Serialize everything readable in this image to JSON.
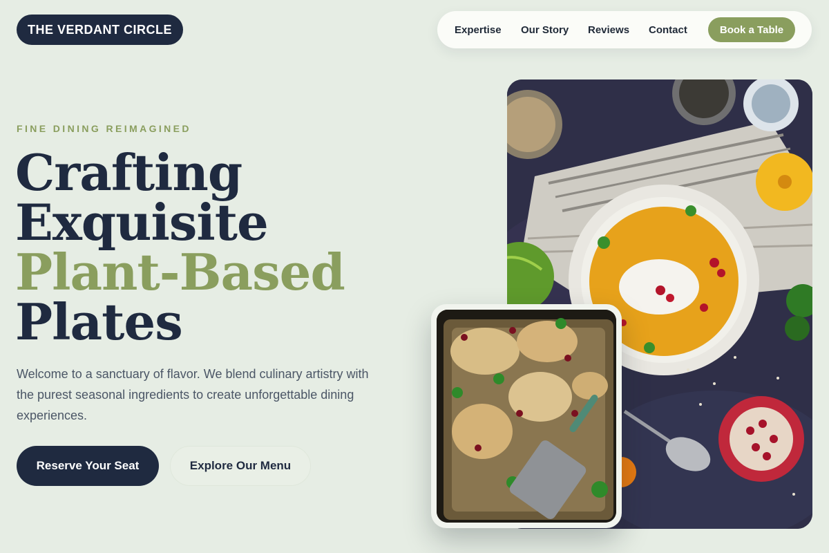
{
  "brand": {
    "name": "THE VERDANT CIRCLE"
  },
  "nav": {
    "links": [
      "Expertise",
      "Our Story",
      "Reviews",
      "Contact"
    ],
    "cta": "Book a Table"
  },
  "hero": {
    "eyebrow": "FINE DINING REIMAGINED",
    "headline": [
      "Crafting",
      "Exquisite",
      "Plant-Based",
      "Plates"
    ],
    "intro": "Welcome to a sanctuary of flavor. We blend culinary artistry with the purest seasonal ingredients to create unforgettable dining experiences.",
    "primary_button": "Reserve Your Seat",
    "secondary_button": "Explore Our Menu"
  },
  "colors": {
    "background": "#e6ede4",
    "navy": "#1f2a40",
    "olive_accent": "#8a9e5e"
  },
  "images": {
    "main": "pumpkin-soup-photo",
    "secondary": "roasted-cauliflower-photo"
  }
}
